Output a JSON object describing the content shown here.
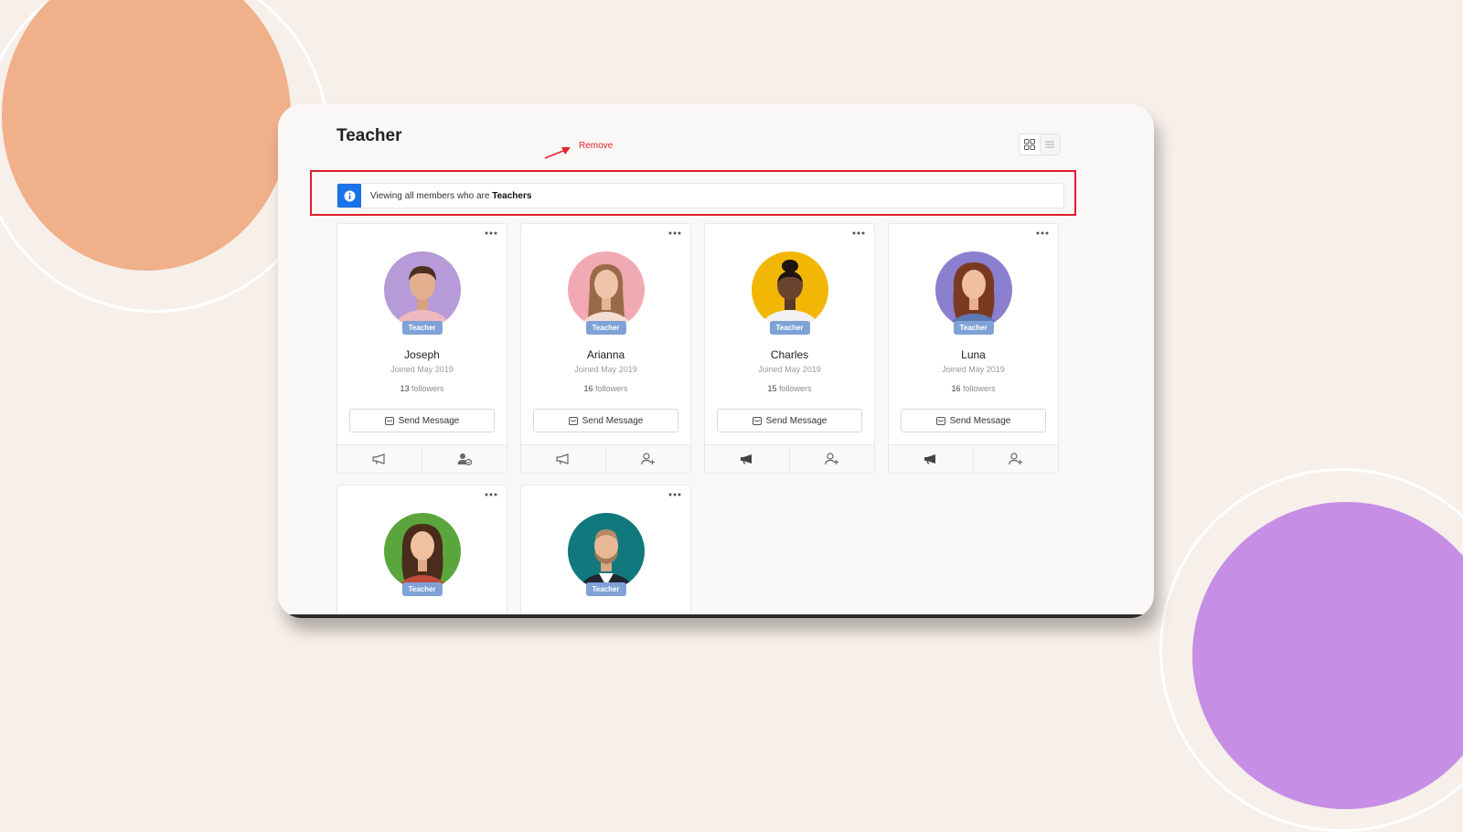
{
  "page": {
    "title": "Teacher"
  },
  "view_toggle": {
    "grid_icon": "grid-icon",
    "list_icon": "list-icon"
  },
  "annotation": {
    "label": "Remove",
    "color": "#e11d2b"
  },
  "notice": {
    "prefix": "Viewing all members who are ",
    "emphasis": "Teachers",
    "icon": "info-icon",
    "icon_bg": "#1a73e8"
  },
  "members": [
    {
      "name": "Joseph",
      "badge": "Teacher",
      "joined": "Joined May 2019",
      "followers_count": "13",
      "followers_label": " followers",
      "send_label": "Send Message",
      "avatar_bg": "#b79ad8",
      "follow_state": "following"
    },
    {
      "name": "Arianna",
      "badge": "Teacher",
      "joined": "Joined May 2019",
      "followers_count": "16",
      "followers_label": " followers",
      "send_label": "Send Message",
      "avatar_bg": "#f1a9b3",
      "follow_state": "not-following"
    },
    {
      "name": "Charles",
      "badge": "Teacher",
      "joined": "Joined May 2019",
      "followers_count": "15",
      "followers_label": " followers",
      "send_label": "Send Message",
      "avatar_bg": "#f2b705",
      "follow_state": "muted"
    },
    {
      "name": "Luna",
      "badge": "Teacher",
      "joined": "Joined May 2019",
      "followers_count": "16",
      "followers_label": " followers",
      "send_label": "Send Message",
      "avatar_bg": "#8b7fd0",
      "follow_state": "muted"
    },
    {
      "badge": "Teacher",
      "avatar_bg": "#5aa63c"
    },
    {
      "badge": "Teacher",
      "avatar_bg": "#11797e"
    }
  ]
}
